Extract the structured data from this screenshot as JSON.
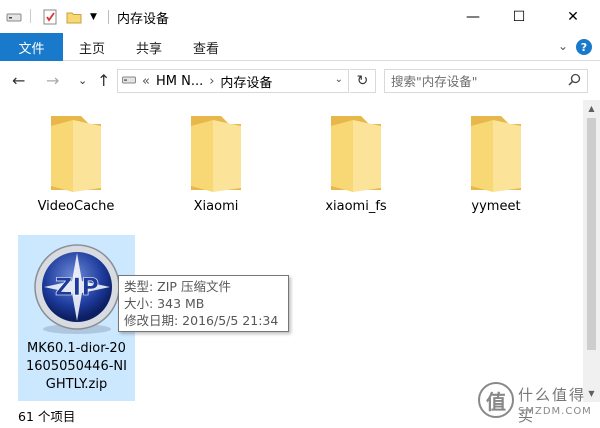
{
  "window": {
    "title": "内存设备",
    "controls": {
      "minimize": "—",
      "maximize": "☐",
      "close": "✕"
    }
  },
  "ribbon": {
    "file_tab": "文件",
    "tabs": [
      "主页",
      "共享",
      "查看"
    ],
    "expand_chevron": "⌄",
    "help": "?"
  },
  "nav": {
    "back": "←",
    "forward": "→",
    "recent": "⌄",
    "up": "↑",
    "breadcrumb": {
      "overflow": "«",
      "items": [
        "HM N...",
        "内存设备"
      ],
      "separator": "›"
    },
    "address_dropdown": "⌄",
    "refresh": "↻",
    "search_placeholder": "搜索\"内存设备\""
  },
  "items": [
    {
      "name": "VideoCache",
      "type": "folder"
    },
    {
      "name": "Xiaomi",
      "type": "folder"
    },
    {
      "name": "xiaomi_fs",
      "type": "folder"
    },
    {
      "name": "yymeet",
      "type": "folder"
    }
  ],
  "zip_item": {
    "name": "MK60.1-dior-20 1605050446-NI GHTLY.zip",
    "icon_text": "ZIP",
    "selected": true
  },
  "tooltip": {
    "type_line": "类型: ZIP 压缩文件",
    "size_line": "大小: 343 MB",
    "date_line": "修改日期: 2016/5/5 21:34"
  },
  "status": {
    "count": "61 个项目"
  },
  "watermark": {
    "glyph": "值",
    "text": "什么值得买",
    "sub": "SMZDM.COM"
  },
  "colors": {
    "accent": "#1979ca",
    "selection": "#cce8ff",
    "folder": "#f8d775",
    "folder_dark": "#e7b74a"
  }
}
